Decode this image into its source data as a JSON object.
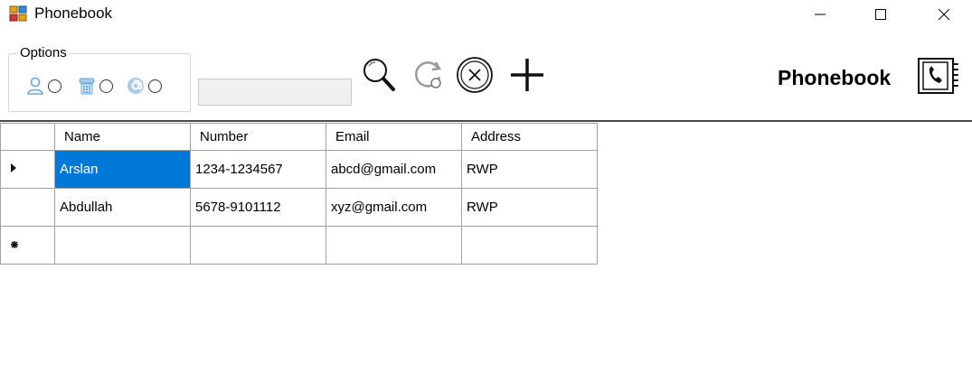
{
  "window": {
    "title": "Phonebook"
  },
  "options": {
    "label": "Options",
    "items": [
      {
        "icon": "person-icon"
      },
      {
        "icon": "telephone-icon"
      },
      {
        "icon": "at-sign-icon"
      }
    ]
  },
  "search": {
    "value": ""
  },
  "toolbar": {
    "icons": [
      "search-icon",
      "refresh-icon",
      "clear-icon",
      "add-icon"
    ]
  },
  "brand": {
    "label": "Phonebook",
    "icon": "phonebook-icon"
  },
  "grid": {
    "columns": [
      "Name",
      "Number",
      "Email",
      "Address"
    ],
    "rows": [
      {
        "indicator": "current-row-arrow",
        "cells": [
          "Arslan",
          "1234-1234567",
          "abcd@gmail.com",
          "RWP"
        ]
      },
      {
        "indicator": "",
        "cells": [
          "Abdullah",
          "5678-9101112",
          "xyz@gmail.com",
          "RWP"
        ]
      },
      {
        "indicator": "new-row-star",
        "cells": [
          "",
          "",
          "",
          ""
        ]
      }
    ],
    "selected_cell": {
      "row": 0,
      "column": "Name"
    }
  },
  "colors": {
    "selection": "#0078d7",
    "accent_icon": "#6aa7d8"
  }
}
